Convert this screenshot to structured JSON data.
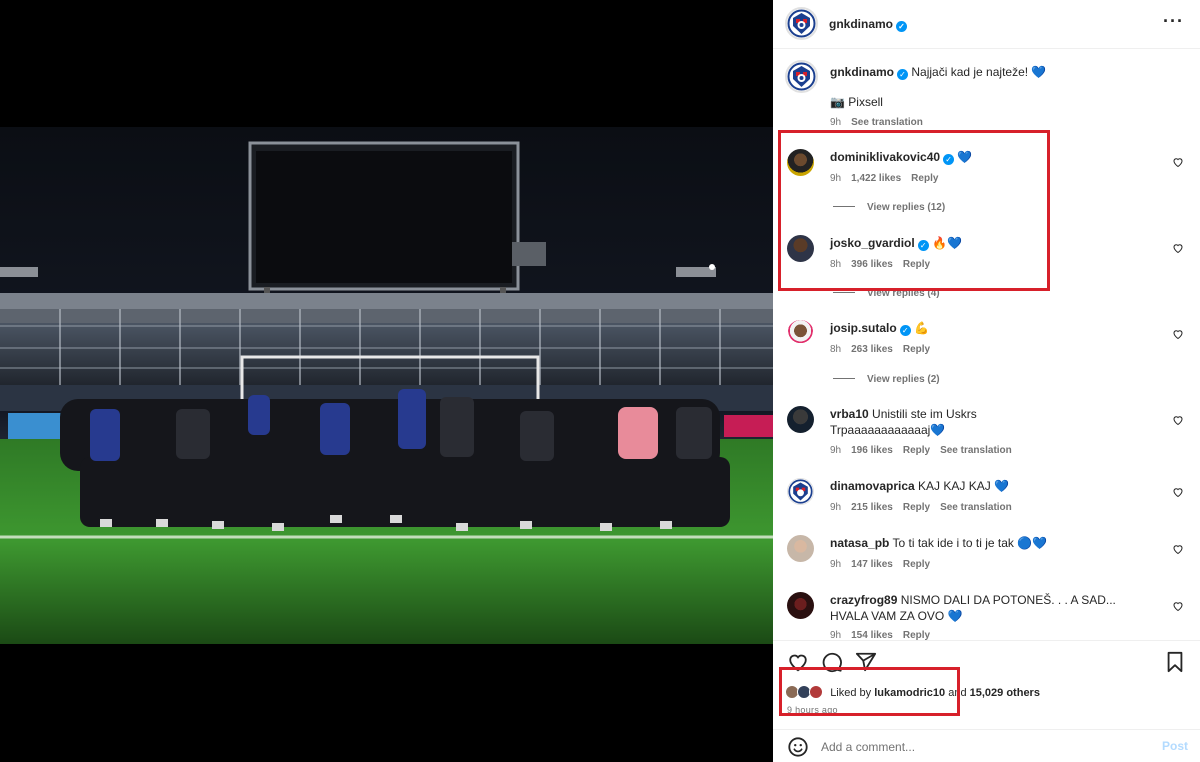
{
  "post": {
    "author": "gnkdinamo",
    "caption": "Najjači kad je najteže!",
    "credit": "📷 Pixsell",
    "time": "9h",
    "see_translation": "See translation"
  },
  "comments": [
    {
      "user": "dominiklivakovic40",
      "text": "💙",
      "time": "9h",
      "likes": "1,422 likes",
      "reply": "Reply",
      "view_replies": "View replies (12)",
      "verified": true
    },
    {
      "user": "josko_gvardiol",
      "text": "🔥💙",
      "time": "8h",
      "likes": "396 likes",
      "reply": "Reply",
      "view_replies": "View replies (4)",
      "verified": true
    },
    {
      "user": "josip.sutalo",
      "text": "💪",
      "time": "8h",
      "likes": "263 likes",
      "reply": "Reply",
      "view_replies": "View replies (2)",
      "verified": true
    },
    {
      "user": "vrba10",
      "text": "Unistili ste im Uskrs Trpaaaaaaaaaaaaj💙",
      "time": "9h",
      "likes": "196 likes",
      "reply": "Reply",
      "see_translation": "See translation"
    },
    {
      "user": "dinamovaprica",
      "text": "KAJ KAJ KAJ 💙",
      "time": "9h",
      "likes": "215 likes",
      "reply": "Reply",
      "see_translation": "See translation"
    },
    {
      "user": "natasa_pb",
      "text": "To ti tak ide i to ti je tak 🔵💙",
      "time": "9h",
      "likes": "147 likes",
      "reply": "Reply"
    },
    {
      "user": "crazyfrog89",
      "text": "NISMO DALI DA POTONEŠ. . . A SAD... HVALA VAM ZA OVO 💙",
      "time": "9h",
      "likes": "154 likes",
      "reply": "Reply"
    }
  ],
  "likes": {
    "prefix": "Liked by",
    "user": "lukamodric10",
    "middle": "and",
    "others": "15,029 others"
  },
  "time_ago": "9 hours ago",
  "add_comment": {
    "placeholder": "Add a comment...",
    "post_label": "Post"
  },
  "icons": [
    "more-icon",
    "verified-icon",
    "heart-icon",
    "comment-icon",
    "share-icon",
    "bookmark-icon",
    "emoji-icon"
  ],
  "colors": {
    "verified": "#0095f6",
    "highlight": "#d7202a",
    "post_button": "#b3dbff"
  }
}
